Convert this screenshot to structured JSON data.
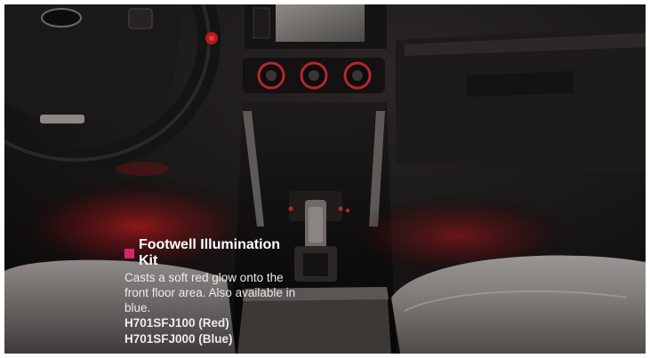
{
  "caption": {
    "title": "Footwell Illumination Kit",
    "description": "Casts a soft red glow onto the front floor area. Also available in blue.",
    "part_numbers": [
      "H701SFJ100 (Red)",
      "H701SFJ000 (Blue)"
    ],
    "bullet_color": "#d2276e"
  },
  "scene": {
    "subject": "car-interior-footwell-lighting",
    "glow_color": "#c4201e"
  }
}
